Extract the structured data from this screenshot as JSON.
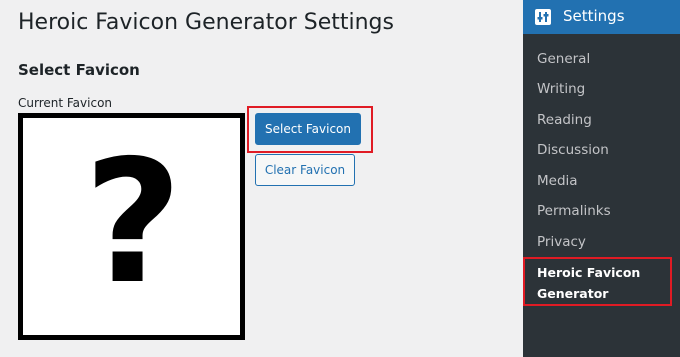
{
  "page": {
    "title": "Heroic Favicon Generator Settings",
    "section_title": "Select Favicon",
    "current_favicon_label": "Current Favicon",
    "current_favicon_glyph": "?"
  },
  "buttons": {
    "select_favicon": "Select Favicon",
    "clear_favicon": "Clear Favicon"
  },
  "sidebar": {
    "title": "Settings",
    "icon": "settings-sliders-icon",
    "items": [
      {
        "label": "General"
      },
      {
        "label": "Writing"
      },
      {
        "label": "Reading"
      },
      {
        "label": "Discussion"
      },
      {
        "label": "Media"
      },
      {
        "label": "Permalinks"
      },
      {
        "label": "Privacy"
      },
      {
        "label_line1": "Heroic Favicon",
        "label_line2": "Generator",
        "active": true
      }
    ]
  },
  "colors": {
    "background": "#f0f0f1",
    "primary": "#2271b1",
    "sidebar": "#2c3338",
    "highlight": "#e01b24"
  }
}
